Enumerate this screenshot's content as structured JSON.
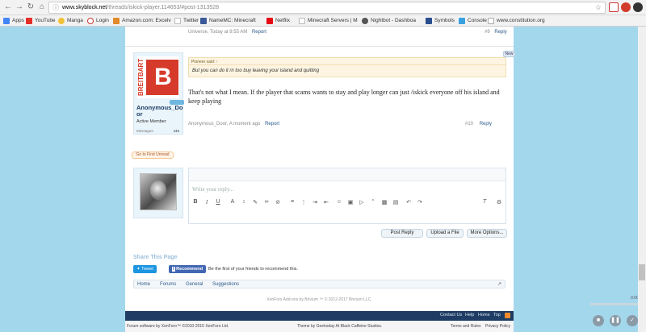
{
  "browser": {
    "url_host": "www.skyblock.net",
    "url_path": "/threads/iskick-player.114653/#post-1313528",
    "bookmarks": [
      "Apps",
      "YouTube",
      "Manga",
      "Login",
      "Amazon.com: Excelv",
      "Twitter",
      "NameMC: Minecraft",
      "Netflix",
      "Minecraft Servers | M",
      "Nightbot - Dashboa",
      "Symbols",
      "Console",
      "www.constitution.org"
    ],
    "colors": {
      "youtube": "#e52d27",
      "twitter": "#1da1f2",
      "facebook": "#3b5998",
      "netflix": "#e50914",
      "ext_red": "#d23c2c"
    }
  },
  "prev_post": {
    "meta": "Universe, Today at 8:55 AM",
    "report": "Report",
    "num": "#9",
    "reply": "Reply"
  },
  "new_badge": "New",
  "post": {
    "author": "Anonymous_Door",
    "author_wrapped": [
      "Anonymous_Do",
      "or"
    ],
    "staff_badge": "",
    "role": "Active Member",
    "messages_label": "Messages:",
    "messages_count": "446",
    "quote_header": "Pioneer said: ↑",
    "quote_text": "But you can do it rn too buy leaving your island and quitting",
    "body": "That's not what I mean. If the player that scams wants to stay and play longer can just /iskick everyone off his island and keep playing",
    "meta": "Anonymous_Door, A moment ago",
    "report": "Report",
    "num": "#10",
    "reply": "Reply"
  },
  "go_first_unread": "Go to First Unread",
  "editor": {
    "placeholder": "Write your reply...",
    "post_reply": "Post Reply",
    "upload": "Upload a File",
    "more": "More Options..."
  },
  "share": {
    "title": "Share This Page",
    "tweet": "Tweet",
    "recommend": "Recommend",
    "recommend_text": "Be the first of your friends to recommend this."
  },
  "breadcrumb": [
    "Home",
    "Forums",
    "General",
    "Suggestions"
  ],
  "addons": "XenForo Add-ons by Brivium ™ © 2012-2017 Brivium LLC.",
  "footer_links": [
    "Contact Us",
    "Help",
    "Home",
    "Top"
  ],
  "footer": {
    "left": "Forum software by XenForo™ ©2010-2015 XenForo Ltd.",
    "center": "Theme by Geekoday At Black Caffeine Studios.",
    "terms": "Terms and Rules",
    "privacy": "Privacy Policy"
  },
  "player_time": "0:00"
}
